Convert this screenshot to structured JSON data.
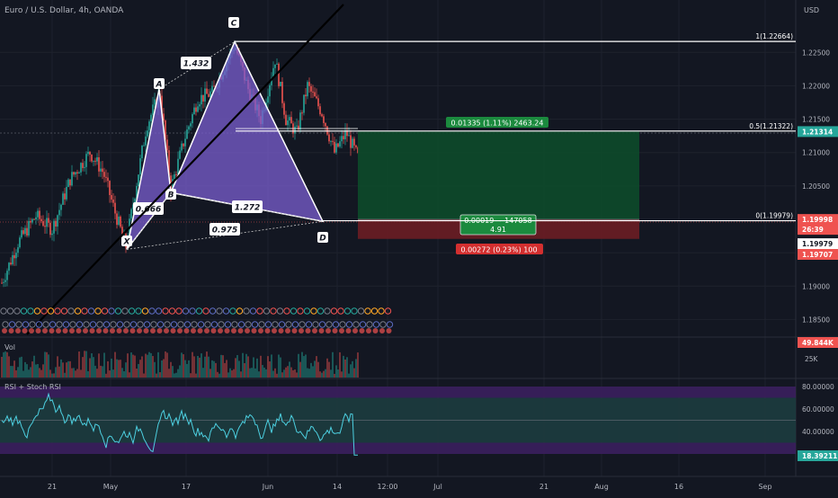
{
  "header": {
    "title": "Euro / U.S. Dollar, 4h, OANDA",
    "currency": "USD"
  },
  "colors": {
    "bg": "#131722",
    "grid": "#1e222d",
    "up": "#26a69a",
    "down": "#ef5350",
    "pattern": "#7b5fd0",
    "profit_zone": "#0d4a2a",
    "loss_zone": "#6b1d23",
    "rsi_line": "#4dd0e1",
    "rsi_band": "#3b1f5e",
    "rsi_mid": "#1d3c3f"
  },
  "chart_data": {
    "type": "candlestick",
    "title": "Euro / U.S. Dollar, 4h, OANDA",
    "x_ticks": [
      "21",
      "May",
      "17",
      "Jun",
      "14",
      "12:00",
      "Jul",
      "21",
      "Aug",
      "16",
      "Sep"
    ],
    "y_ticks": [
      1.225,
      1.22,
      1.215,
      1.21,
      1.205,
      1.2,
      1.195,
      1.19,
      1.185
    ],
    "ylim": [
      1.1825,
      1.2315
    ],
    "harmonic_pattern": {
      "points": [
        {
          "label": "X",
          "price": 1.1955
        },
        {
          "label": "A",
          "price": 1.2195
        },
        {
          "label": "B",
          "price": 1.204
        },
        {
          "label": "C",
          "price": 1.2266
        },
        {
          "label": "D",
          "price": 1.1997
        }
      ],
      "ratios": [
        {
          "text": "0.666",
          "between": "X-B"
        },
        {
          "text": "1.432",
          "between": "A-C"
        },
        {
          "text": "1.272",
          "between": "B-D"
        },
        {
          "text": "0.975",
          "between": "X-D"
        }
      ]
    },
    "fib_levels": [
      {
        "label": "1(1.22664)",
        "price": 1.22664
      },
      {
        "label": "0.5(1.21322)",
        "price": 1.21322
      },
      {
        "label": "0(1.19979)",
        "price": 1.19979
      }
    ],
    "position": {
      "target_label": "0.01335 (1.11%) 2463.24",
      "center_label_1": "0.00019 ~ 147058",
      "center_label_2": "4.91",
      "stop_label": "0.00272 (0.23%) 100",
      "entry": 1.19998,
      "target": 1.21314,
      "stop": 1.19707
    },
    "price_tags": [
      {
        "text": "1.21314",
        "color": "#26a69a",
        "price": 1.21314
      },
      {
        "text": "1.19998",
        "color": "#ef5350",
        "price": 1.19998
      },
      {
        "text": "26:39",
        "color": "#ef5350",
        "price": 1.1985
      },
      {
        "text": "1.19979",
        "color": "#ffffff",
        "price": 1.19635
      },
      {
        "text": "1.19707",
        "color": "#ef5350",
        "price": 1.19475
      }
    ],
    "volume": {
      "label": "Vol",
      "last_value": "49.844K",
      "y_tick": "25K"
    },
    "rsi": {
      "label": "RSI + Stoch RSI",
      "y_ticks": [
        "80.00000",
        "60.00000",
        "40.00000"
      ],
      "last_value": "18.39211",
      "upper_band": [
        80,
        70
      ],
      "lower_band": [
        30,
        20
      ]
    }
  }
}
